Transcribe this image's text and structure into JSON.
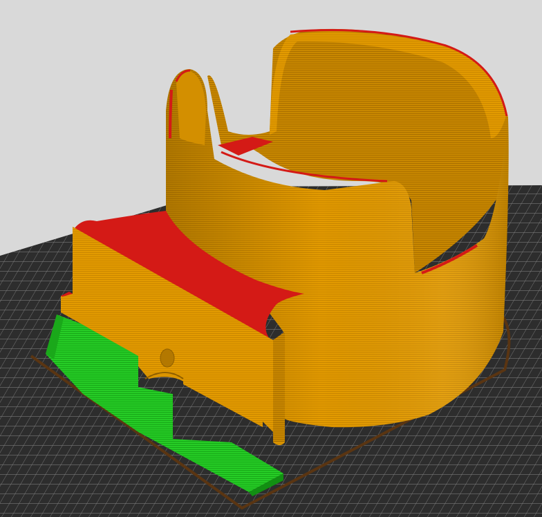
{
  "viewer": {
    "background_color": "#d9d9d9",
    "bed": {
      "color": "#2d2d2d",
      "grid_line_color": "#8a8a8a"
    }
  },
  "model": {
    "feature_colors": {
      "wall": "#e8a000",
      "wall_dark": "#b07600",
      "top_solid_infill": "#d41a16",
      "support_brim": "#21c421",
      "skirt": "#5a3512"
    }
  }
}
